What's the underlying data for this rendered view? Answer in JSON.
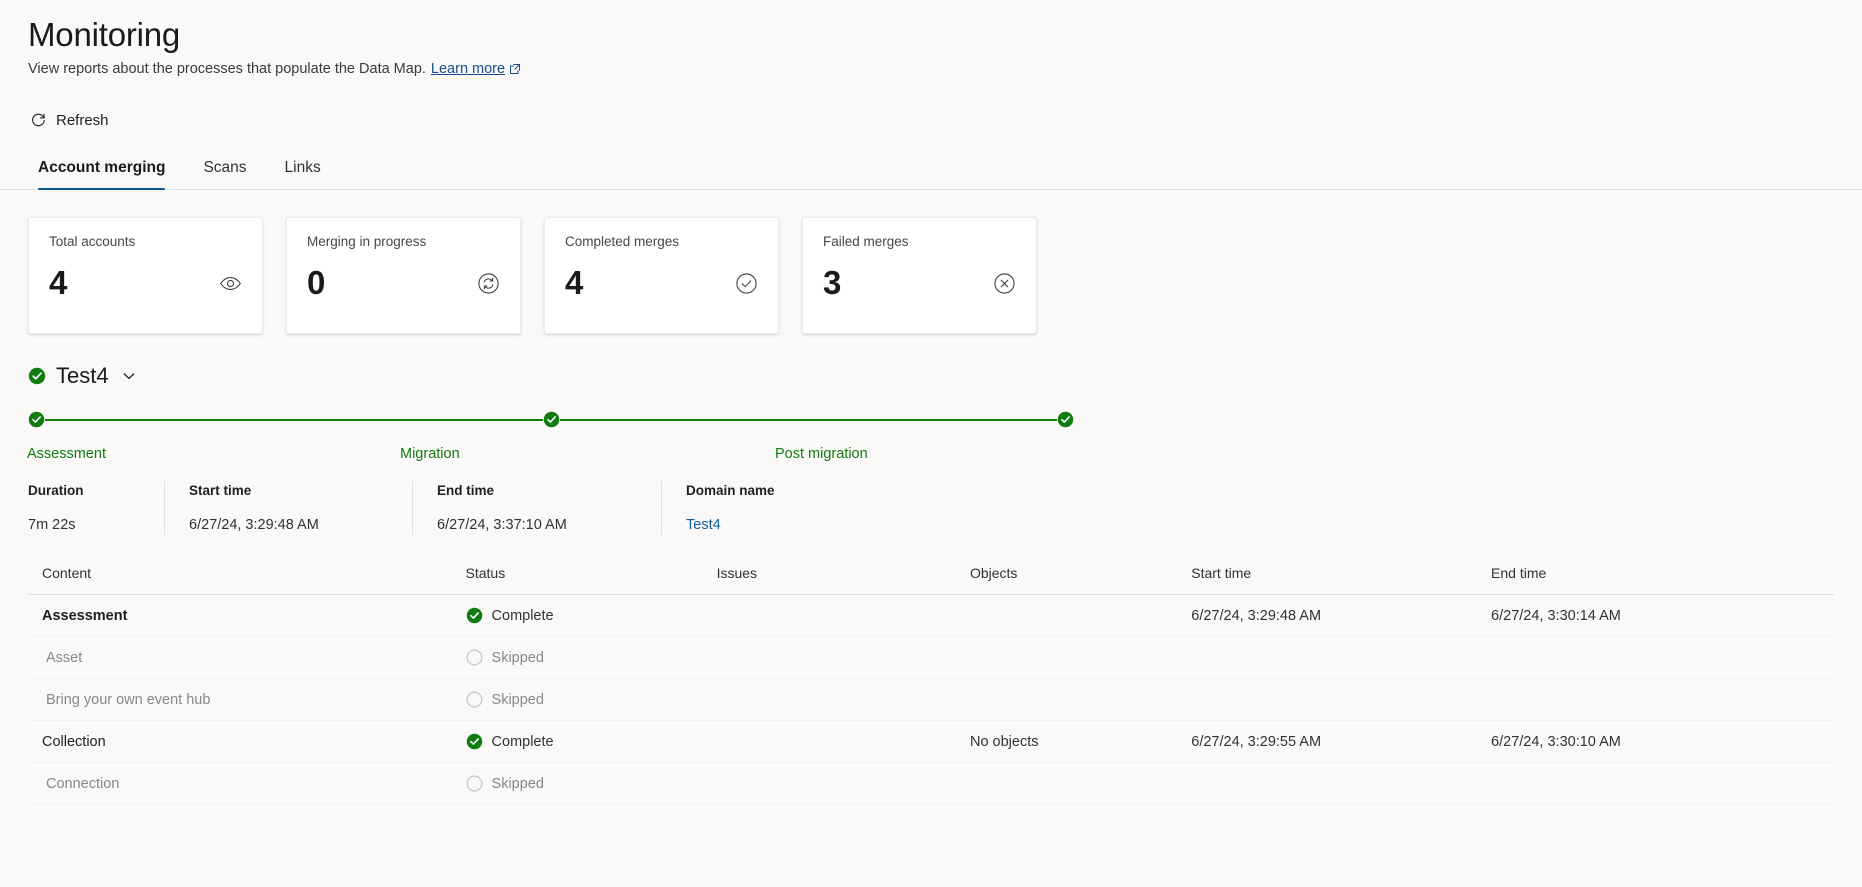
{
  "header": {
    "title": "Monitoring",
    "subtitle": "View reports about the processes that populate the Data Map.",
    "learn_more": "Learn more",
    "learn_more_icon": "external-link-icon"
  },
  "commandbar": {
    "refresh_label": "Refresh",
    "refresh_icon": "refresh-icon"
  },
  "tabs": [
    {
      "label": "Account merging",
      "active": true
    },
    {
      "label": "Scans",
      "active": false
    },
    {
      "label": "Links",
      "active": false
    }
  ],
  "cards": [
    {
      "label": "Total accounts",
      "value": "4",
      "icon": "eye-icon"
    },
    {
      "label": "Merging in progress",
      "value": "0",
      "icon": "sync-circle-icon"
    },
    {
      "label": "Completed merges",
      "value": "4",
      "icon": "check-circle-icon"
    },
    {
      "label": "Failed merges",
      "value": "3",
      "icon": "x-circle-icon"
    }
  ],
  "run": {
    "name": "Test4",
    "status_icon": "success-check-circle-icon",
    "expand_icon": "chevron-down-icon",
    "steps": [
      {
        "label": "Assessment",
        "icon": "success-check-circle-icon"
      },
      {
        "label": "Migration",
        "icon": "success-check-circle-icon"
      },
      {
        "label": "Post migration",
        "icon": "success-check-circle-icon"
      }
    ],
    "details": [
      {
        "label": "Duration",
        "value": "7m 22s",
        "link": false
      },
      {
        "label": "Start time",
        "value": "6/27/24, 3:29:48 AM",
        "link": false
      },
      {
        "label": "End time",
        "value": "6/27/24, 3:37:10 AM",
        "link": false
      },
      {
        "label": "Domain name",
        "value": "Test4",
        "link": true
      }
    ]
  },
  "table": {
    "columns": [
      "Content",
      "Status",
      "Issues",
      "Objects",
      "Start time",
      "End time"
    ],
    "rows": [
      {
        "kind": "main",
        "content": "Assessment",
        "status": "Complete",
        "status_icon": "check-filled-icon",
        "issues": "",
        "objects": "",
        "start": "6/27/24, 3:29:48 AM",
        "end": "6/27/24, 3:30:14 AM"
      },
      {
        "kind": "sub",
        "content": "Asset",
        "status": "Skipped",
        "status_icon": "circle-outline-icon",
        "issues": "",
        "objects": "",
        "start": "",
        "end": ""
      },
      {
        "kind": "sub",
        "content": "Bring your own event hub",
        "status": "Skipped",
        "status_icon": "circle-outline-icon",
        "issues": "",
        "objects": "",
        "start": "",
        "end": ""
      },
      {
        "kind": "norm",
        "content": "Collection",
        "status": "Complete",
        "status_icon": "check-filled-icon",
        "issues": "",
        "objects": "No objects",
        "start": "6/27/24, 3:29:55 AM",
        "end": "6/27/24, 3:30:10 AM"
      },
      {
        "kind": "sub",
        "content": "Connection",
        "status": "Skipped",
        "status_icon": "circle-outline-icon",
        "issues": "",
        "objects": "",
        "start": "",
        "end": ""
      }
    ]
  },
  "colors": {
    "accent": "#0f548c",
    "link": "#115ea3",
    "success": "#107c10",
    "background": "#faf9f8",
    "card": "#ffffff",
    "muted_text": "#8a8886"
  }
}
